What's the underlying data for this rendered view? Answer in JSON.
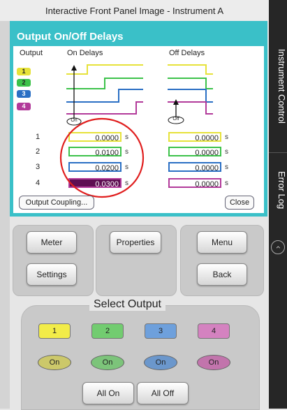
{
  "window": {
    "title": "Interactive Front Panel Image - Instrument A"
  },
  "side_tabs": [
    {
      "label": "Instrument Control"
    },
    {
      "label": "Error Log"
    }
  ],
  "panel": {
    "title": "Output On/Off Delays",
    "col_output": "Output",
    "col_on": "On Delays",
    "col_off": "Off Delays",
    "on_marker": "On",
    "off_marker": "Off",
    "unit": "s",
    "rows": [
      {
        "num": "1",
        "on": "0.0000",
        "off": "0.0000",
        "color": "#e6e23a"
      },
      {
        "num": "2",
        "on": "0.0100",
        "off": "0.0000",
        "color": "#3cc24a"
      },
      {
        "num": "3",
        "on": "0.0200",
        "off": "0.0000",
        "color": "#2a6fc4"
      },
      {
        "num": "4",
        "on": "0.0300",
        "off": "0.0000",
        "color": "#b23a9a"
      }
    ],
    "coupling_button": "Output Coupling...",
    "close_button": "Close"
  },
  "controls": {
    "meter": "Meter",
    "properties": "Properties",
    "menu": "Menu",
    "settings": "Settings",
    "back": "Back",
    "select_output": "Select Output",
    "outputs": [
      "1",
      "2",
      "3",
      "4"
    ],
    "on_label": "On",
    "all_on": "All On",
    "all_off": "All Off"
  },
  "highlight_color": "#e01e1e"
}
